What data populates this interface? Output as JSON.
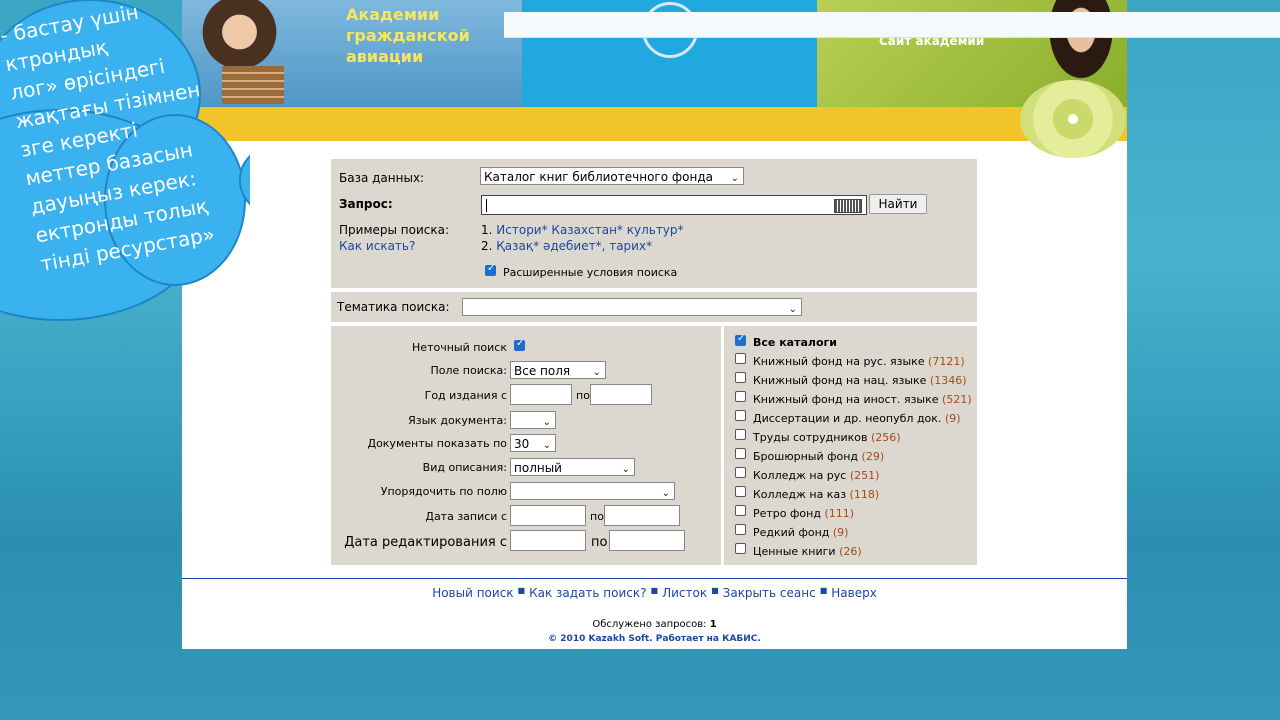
{
  "header": {
    "title_lines": [
      "Академии",
      "гражданской",
      "авиации"
    ],
    "right_link": "Сайт академии"
  },
  "cloud_text": [
    "- бастау үшін",
    "ктрондық",
    "лог» өрісіндегі",
    "жақтағы тізімнен",
    "згe керекті",
    "меттер базасын",
    "дауыңыз керек:",
    "ектронды толық",
    "тінді ресурстар»"
  ],
  "search": {
    "db_label": "База данных:",
    "db_value": "Каталог книг библиотечного фонда",
    "query_label": "Запрос:",
    "query_value": "",
    "find_button": "Найти",
    "examples_label": "Примеры поиска:",
    "how_label": "Как искать?",
    "example1_num": "1.",
    "example1": "Истори* Казахстан* культур*",
    "example2_num": "2.",
    "example2": "Қазақ* әдебиет*, тарих*",
    "advanced_label": "Расширенные условия поиска",
    "advanced_checked": true
  },
  "theme": {
    "label": "Тематика поиска:",
    "value": ""
  },
  "advanced": {
    "fuzzy_label": "Неточный поиск",
    "field_label": "Поле поиска:",
    "field_value": "Все поля",
    "year_label": "Год издания с",
    "year_to": "по",
    "lang_label": "Язык документа:",
    "docs_label": "Документы показать по",
    "docs_value": "30",
    "view_label": "Вид описания:",
    "view_value": "полный",
    "sort_label": "Упорядочить по полю",
    "rec_label": "Дата записи с",
    "rec_to": "по",
    "edit_label": "Дата редактирования с",
    "edit_to": "по"
  },
  "catalogs": {
    "all": "Все каталоги",
    "items": [
      {
        "label": "Книжный фонд на рус. языке",
        "count": "(7121)"
      },
      {
        "label": "Книжный фонд на нац. языке",
        "count": "(1346)"
      },
      {
        "label": "Книжный фонд на иност. языке",
        "count": "(521)"
      },
      {
        "label": "Диссертации и др. неопубл док.",
        "count": "(9)"
      },
      {
        "label": "Труды сотрудников",
        "count": "(256)"
      },
      {
        "label": "Брошюрный фонд",
        "count": "(29)"
      },
      {
        "label": "Колледж на рус",
        "count": "(251)"
      },
      {
        "label": "Колледж на каз",
        "count": "(118)"
      },
      {
        "label": "Ретро фонд",
        "count": "(111)"
      },
      {
        "label": "Редкий фонд",
        "count": "(9)"
      },
      {
        "label": "Ценные книги",
        "count": "(26)"
      }
    ]
  },
  "footer": {
    "links": [
      "Новый поиск",
      "Как задать поиск?",
      "Листок",
      "Закрыть сеанс",
      "Наверх"
    ],
    "served_label": "Обслужено запросов:",
    "served_count": "1",
    "copyright": "© 2010 Kazakh Soft. Работает на КАБИС."
  }
}
